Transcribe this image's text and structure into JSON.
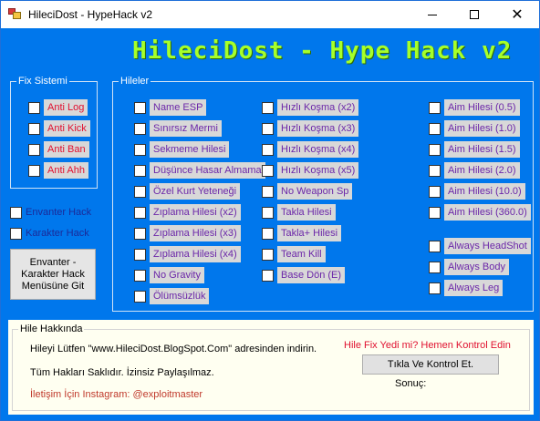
{
  "window": {
    "title": "HileciDost - HypeHack v2",
    "minimize": "minimize",
    "maximize": "maximize",
    "close": "✕"
  },
  "heading": "HileciDost - Hype Hack v2",
  "colors": {
    "accent_bg": "#0077ec",
    "heading": "#a6ff2a",
    "label_purple": "#6b26a8",
    "label_red": "#e0102f"
  },
  "fix_sistemi": {
    "legend": "Fix Sistemi",
    "items": [
      {
        "label": "Anti Log",
        "checked": false
      },
      {
        "label": "Anti Kick",
        "checked": false
      },
      {
        "label": "Anti Ban",
        "checked": false
      },
      {
        "label": "Anti Ahh",
        "checked": false
      }
    ]
  },
  "side_options": [
    {
      "label": "Envanter Hack",
      "checked": false
    },
    {
      "label": "Karakter Hack",
      "checked": false
    }
  ],
  "menu_button": {
    "line1": "Envanter -",
    "line2": "Karakter Hack",
    "line3": "Menüsüne Git"
  },
  "hileler": {
    "legend": "Hileler",
    "col1": [
      {
        "label": "Name ESP",
        "checked": false
      },
      {
        "label": "Sınırsız Mermi",
        "checked": false
      },
      {
        "label": "Sekmeme Hilesi",
        "checked": false
      },
      {
        "label": "Düşünce Hasar Almama",
        "checked": false
      },
      {
        "label": "Özel Kurt Yeteneği",
        "checked": false
      },
      {
        "label": "Zıplama Hilesi (x2)",
        "checked": false
      },
      {
        "label": "Zıplama Hilesi (x3)",
        "checked": false
      },
      {
        "label": "Zıplama Hilesi (x4)",
        "checked": false
      },
      {
        "label": "No Gravity",
        "checked": false
      },
      {
        "label": "Ölümsüzlük",
        "checked": false
      }
    ],
    "col2": [
      {
        "label": "Hızlı Koşma (x2)",
        "checked": false
      },
      {
        "label": "Hızlı Koşma (x3)",
        "checked": false
      },
      {
        "label": "Hızlı Koşma (x4)",
        "checked": false
      },
      {
        "label": "Hızlı Koşma (x5)",
        "checked": false
      },
      {
        "label": "No Weapon Sp",
        "checked": false
      },
      {
        "label": "Takla Hilesi",
        "checked": false
      },
      {
        "label": "Takla+ Hilesi",
        "checked": false
      },
      {
        "label": "Team Kill",
        "checked": false
      },
      {
        "label": "Base Dön (E)",
        "checked": false
      }
    ],
    "col3": [
      {
        "label": "Aim Hilesi (0.5)",
        "checked": false
      },
      {
        "label": "Aim Hilesi (1.0)",
        "checked": false
      },
      {
        "label": "Aim Hilesi (1.5)",
        "checked": false
      },
      {
        "label": "Aim Hilesi (2.0)",
        "checked": false
      },
      {
        "label": "Aim Hilesi (10.0)",
        "checked": false
      },
      {
        "label": "Aim Hilesi (360.0)",
        "checked": false
      }
    ],
    "col3b": [
      {
        "label": "Always HeadShot",
        "checked": false
      },
      {
        "label": "Always Body",
        "checked": false
      },
      {
        "label": "Always Leg",
        "checked": false
      }
    ]
  },
  "about": {
    "legend": "Hile Hakkında",
    "download_text": "Hileyi Lütfen \"www.HileciDost.BlogSpot.Com\" adresinden indirin.",
    "rights_text": "Tüm Hakları Saklıdır. İzinsiz Paylaşılmaz.",
    "contact_text": "İletişim İçin Instagram: @exploitmaster",
    "fix_question": "Hile Fix Yedi mi? Hemen Kontrol Edin",
    "check_button": "Tıkla Ve Kontrol Et.",
    "result_label": "Sonuç:"
  }
}
